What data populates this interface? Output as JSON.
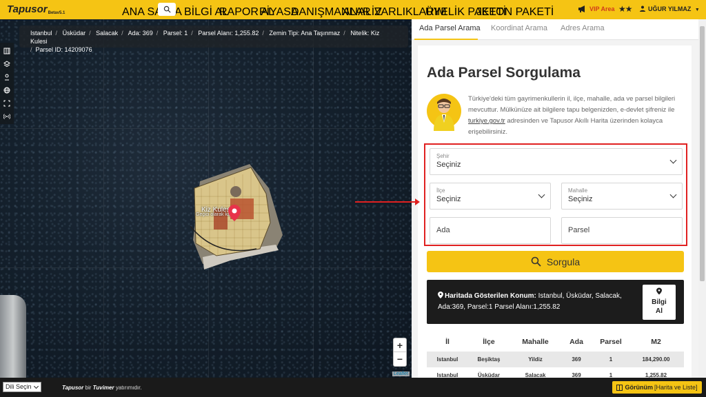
{
  "header": {
    "logo": "Tapusor",
    "logo_version": "Betav5.1",
    "nav": [
      "ANA SAYFA",
      "BİLGİ AL",
      "RAPOR AL",
      "PİYASA",
      "DANIŞMANLAR",
      "ANALİZ",
      "VARLIKLARIM",
      "ÜYELİK PAKETİ",
      "JETON PAKETİ"
    ],
    "vip_label": "VIP Area",
    "stars": "★★",
    "user": "UĞUR YILMAZ"
  },
  "map": {
    "breadcrumb": [
      "Istanbul",
      "Üsküdar",
      "Salacak",
      "Ada: 369",
      "Parsel: 1",
      "Parsel Alanı: 1,255.82",
      "Zemin Tipi: Ana Taşınmaz",
      "Nitelik: Kiz Kulesi",
      "Parsel ID: 14209076"
    ],
    "poi_name": "Kiz Kulesi",
    "poi_status": "Geçici olarak kapalı",
    "zoom_in": "+",
    "zoom_out": "−",
    "attribution": "Leaflet"
  },
  "panel": {
    "tabs": [
      "Ada Parsel Arama",
      "Koordinat Arama",
      "Adres Arama"
    ],
    "title": "Ada Parsel Sorgulama",
    "intro_part1": "Türkiye'deki tüm gayrimenkullerin il, ilçe, mahalle, ada ve parsel bilgileri mevcuttur. Mülkünüze ait bilgilere tapu belgenizden, e-devlet şifreniz ile ",
    "intro_link": "turkiye.gov.tr",
    "intro_part2": " adresinden ve Tapusor Akıllı Harita üzerinden kolayca erişebilirsiniz.",
    "form": {
      "city_label": "Şehir",
      "city_value": "Seçiniz",
      "district_label": "İlçe",
      "district_value": "Seçiniz",
      "neighborhood_label": "Mahalle",
      "neighborhood_value": "Seçiniz",
      "block_placeholder": "Ada",
      "parcel_placeholder": "Parsel"
    },
    "query_button": "Sorgula",
    "location_label": "Haritada Gösterilen Konum:",
    "location_value": " Istanbul, Üsküdar, Salacak, Ada:369, Parsel:1 Parsel Alanı:1,255.82",
    "info_button_line1": "Bilgi",
    "info_button_line2": "Al",
    "table": {
      "headers": [
        "İl",
        "İlçe",
        "Mahalle",
        "Ada",
        "Parsel",
        "M2"
      ],
      "rows": [
        [
          "Istanbul",
          "Beşiktaş",
          "Yildiz",
          "369",
          "1",
          "184,290.00"
        ],
        [
          "Istanbul",
          "Üsküdar",
          "Salacak",
          "369",
          "1",
          "1,255.82"
        ]
      ]
    }
  },
  "footer": {
    "language": "Dili Seçin",
    "brand1": "Tapusor",
    "text_mid": " bir ",
    "brand2": "Tuvimer",
    "text_end": " yatırımıdır.",
    "view_label": "Görünüm",
    "view_value": "[Harita ve Liste]"
  },
  "colors": {
    "accent": "#f5c414",
    "highlight": "#e02020",
    "dark": "#1a1a1a"
  }
}
